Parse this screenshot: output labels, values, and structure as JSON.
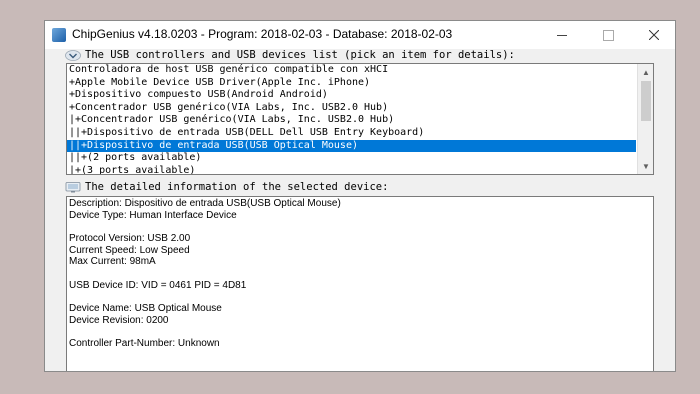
{
  "window": {
    "title": "ChipGenius v4.18.0203 - Program: 2018-02-03 - Database: 2018-02-03"
  },
  "list_section": {
    "label": "The USB controllers and USB devices list (pick an item for details):",
    "rows": [
      "Controladora de host USB genérico compatible con xHCI",
      "+Apple Mobile Device USB Driver(Apple Inc. iPhone)",
      "+Dispositivo compuesto USB(Android Android)",
      "+Concentrador USB genérico(VIA Labs, Inc. USB2.0 Hub)",
      "|+Concentrador USB genérico(VIA Labs, Inc. USB2.0 Hub)",
      "||+Dispositivo de entrada USB(DELL Dell USB Entry Keyboard)",
      "||+Dispositivo de entrada USB(USB Optical Mouse)",
      "||+(2 ports available)",
      "|+(3 ports available)"
    ],
    "selected_index": 6
  },
  "detail_section": {
    "label": "The detailed information of the selected device:",
    "lines": [
      "Description: Dispositivo de entrada USB(USB Optical Mouse)",
      "Device Type: Human Interface Device",
      "",
      "Protocol Version: USB 2.00",
      "Current Speed: Low Speed",
      "Max Current: 98mA",
      "",
      "USB Device ID: VID = 0461 PID = 4D81",
      "",
      "Device Name: USB Optical Mouse",
      "Device Revision: 0200",
      "",
      "Controller Part-Number: Unknown"
    ]
  },
  "icons": {
    "app": "usb-chip-icon",
    "list_label": "chevron-down-icon",
    "detail_label": "monitor-icon"
  },
  "colors": {
    "selection": "#0078d7",
    "background": "#c8bab8"
  }
}
